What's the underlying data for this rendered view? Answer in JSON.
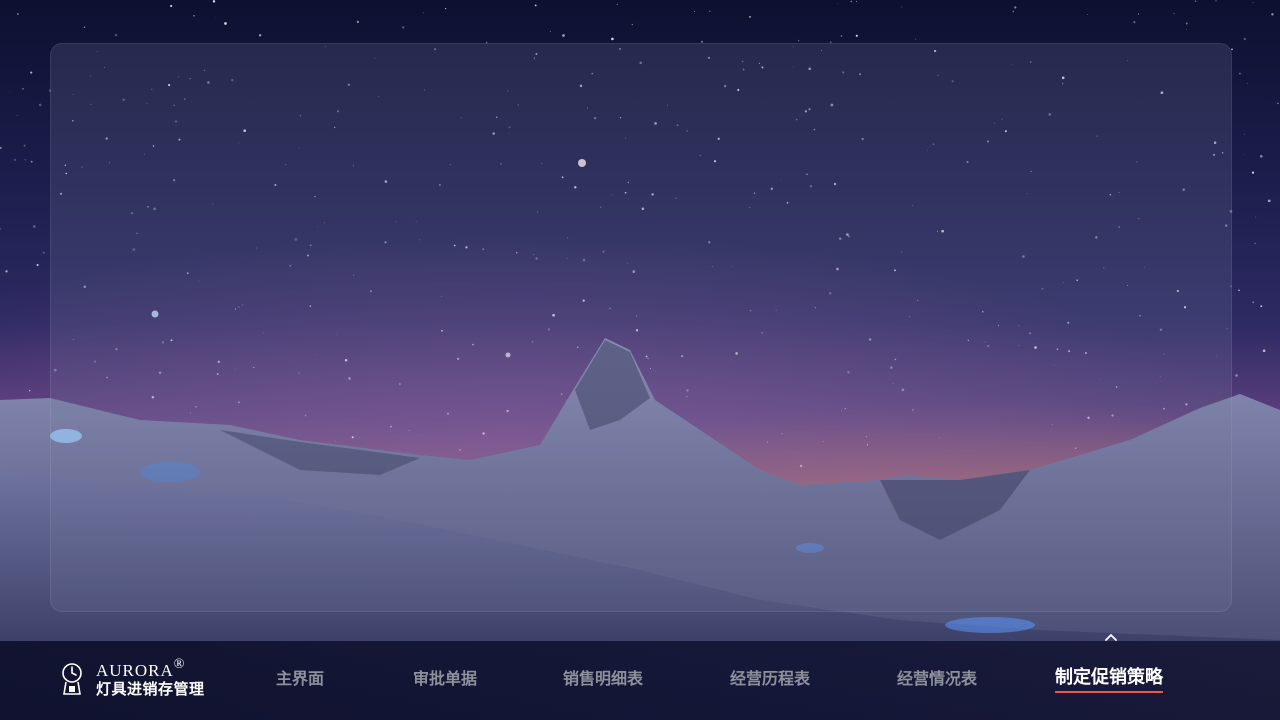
{
  "brand": {
    "name": "AURORA",
    "registered": "®",
    "subtitle": "灯具进销存管理"
  },
  "nav": {
    "items": [
      {
        "label": "主界面",
        "active": false
      },
      {
        "label": "审批单据",
        "active": false
      },
      {
        "label": "销售明细表",
        "active": false
      },
      {
        "label": "经营历程表",
        "active": false
      },
      {
        "label": "经营情况表",
        "active": false
      },
      {
        "label": "制定促销策略",
        "active": true
      }
    ],
    "active_underline_color": "#e8594a"
  },
  "icons": {
    "logo": "clock-lamp-logo-icon",
    "collapse": "chevron-up-icon"
  }
}
